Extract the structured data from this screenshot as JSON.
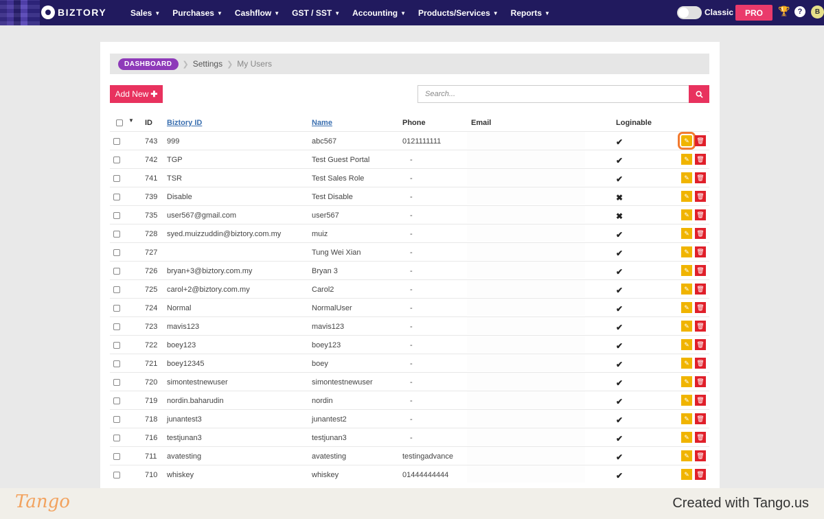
{
  "brand": {
    "logo_text": "BIZTORY"
  },
  "nav": {
    "items": [
      "Sales",
      "Purchases",
      "Cashflow",
      "GST / SST",
      "Accounting",
      "Products/Services",
      "Reports"
    ]
  },
  "topbar_right": {
    "toggle_label": "Classic",
    "pro_label": "PRO",
    "help_glyph": "?",
    "avatar_initial": "B",
    "icons": [
      "trophy-icon",
      "help-icon"
    ]
  },
  "breadcrumb": {
    "dashboard": "DASHBOARD",
    "settings": "Settings",
    "current": "My Users"
  },
  "toolbar": {
    "add_new_label": "Add New",
    "search_placeholder": "Search..."
  },
  "table": {
    "headers": {
      "id": "ID",
      "biztory_id": "Biztory ID",
      "name": "Name",
      "phone": "Phone",
      "email": "Email",
      "loginable": "Loginable"
    },
    "rows": [
      {
        "id": "743",
        "biztory_id": "999",
        "name": "abc567",
        "phone": "0121111111",
        "loginable": "✔"
      },
      {
        "id": "742",
        "biztory_id": "TGP",
        "name": "Test Guest Portal",
        "phone": "-",
        "loginable": "✔"
      },
      {
        "id": "741",
        "biztory_id": "TSR",
        "name": "Test Sales Role",
        "phone": "-",
        "loginable": "✔"
      },
      {
        "id": "739",
        "biztory_id": "Disable",
        "name": "Test Disable",
        "phone": "-",
        "loginable": "✖"
      },
      {
        "id": "735",
        "biztory_id": "user567@gmail.com",
        "name": "user567",
        "phone": "-",
        "loginable": "✖"
      },
      {
        "id": "728",
        "biztory_id": "syed.muizzuddin@biztory.com.my",
        "name": "muiz",
        "phone": "-",
        "loginable": "✔"
      },
      {
        "id": "727",
        "biztory_id": "",
        "name": "Tung Wei Xian",
        "phone": "-",
        "loginable": "✔"
      },
      {
        "id": "726",
        "biztory_id": "bryan+3@biztory.com.my",
        "name": "Bryan 3",
        "phone": "-",
        "loginable": "✔"
      },
      {
        "id": "725",
        "biztory_id": "carol+2@biztory.com.my",
        "name": "Carol2",
        "phone": "-",
        "loginable": "✔"
      },
      {
        "id": "724",
        "biztory_id": "Normal",
        "name": "NormalUser",
        "phone": "-",
        "loginable": "✔"
      },
      {
        "id": "723",
        "biztory_id": "mavis123",
        "name": "mavis123",
        "phone": "-",
        "loginable": "✔"
      },
      {
        "id": "722",
        "biztory_id": "boey123",
        "name": "boey123",
        "phone": "-",
        "loginable": "✔"
      },
      {
        "id": "721",
        "biztory_id": "boey12345",
        "name": "boey",
        "phone": "-",
        "loginable": "✔"
      },
      {
        "id": "720",
        "biztory_id": "simontestnewuser",
        "name": "simontestnewuser",
        "phone": "-",
        "loginable": "✔"
      },
      {
        "id": "719",
        "biztory_id": "nordin.baharudin",
        "name": "nordin",
        "phone": "-",
        "loginable": "✔"
      },
      {
        "id": "718",
        "biztory_id": "junantest3",
        "name": "junantest2",
        "phone": "-",
        "loginable": "✔"
      },
      {
        "id": "716",
        "biztory_id": "testjunan3",
        "name": "testjunan3",
        "phone": "-",
        "loginable": "✔"
      },
      {
        "id": "711",
        "biztory_id": "avatesting",
        "name": "avatesting",
        "phone": "testingadvance",
        "loginable": "✔"
      },
      {
        "id": "710",
        "biztory_id": "whiskey",
        "name": "whiskey",
        "phone": "01444444444",
        "loginable": "✔"
      }
    ]
  },
  "footer": {
    "tango_logo": "Tango",
    "created_with": "Created with Tango.us"
  }
}
